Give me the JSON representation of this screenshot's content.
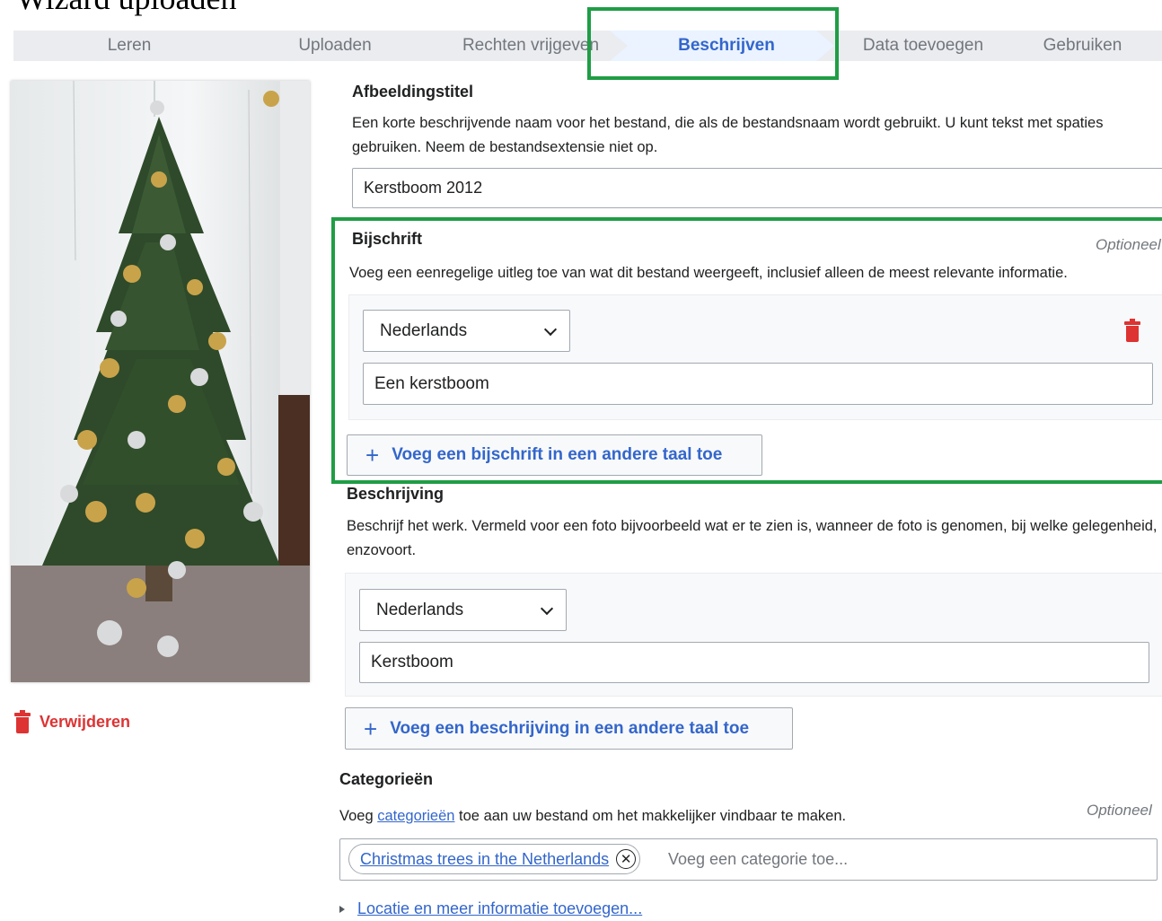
{
  "page_title": "Wizard uploaden",
  "steps": [
    {
      "label": "Leren",
      "active": false
    },
    {
      "label": "Uploaden",
      "active": false
    },
    {
      "label": "Rechten vrijgeven",
      "active": false
    },
    {
      "label": "Beschrijven",
      "active": true
    },
    {
      "label": "Data toevoegen",
      "active": false
    },
    {
      "label": "Gebruiken",
      "active": false
    }
  ],
  "highlight_color": "#1f9d45",
  "remove_label": "Verwijderen",
  "title_field": {
    "label": "Afbeeldingstitel",
    "help": "Een korte beschrijvende naam voor het bestand, die als de bestandsnaam wordt gebruikt. U kunt tekst met spaties gebruiken. Neem de bestandsextensie niet op.",
    "value": "Kerstboom 2012"
  },
  "caption": {
    "label": "Bijschrift",
    "optional": "Optioneel",
    "help": "Voeg een eenregelige uitleg toe van wat dit bestand weergeeft, inclusief alleen de meest relevante informatie.",
    "language": "Nederlands",
    "value": "Een kerstboom",
    "add_button": "Voeg een bijschrift in een andere taal toe"
  },
  "description": {
    "label": "Beschrijving",
    "help": "Beschrijf het werk. Vermeld voor een foto bijvoorbeeld wat er te zien is, wanneer de foto is genomen, bij welke gelegenheid, enzovoort.",
    "language": "Nederlands",
    "value": "Kerstboom",
    "add_button": "Voeg een beschrijving in een andere taal toe"
  },
  "categories": {
    "label": "Categorieën",
    "optional": "Optioneel",
    "help_prefix": "Voeg",
    "help_link": "categorieën",
    "help_suffix": "toe aan uw bestand om het makkelijker vindbaar te maken.",
    "chip": "Christmas trees in the Netherlands",
    "placeholder": "Voeg een categorie toe..."
  },
  "more_info_link": "Locatie en meer informatie toevoegen..."
}
